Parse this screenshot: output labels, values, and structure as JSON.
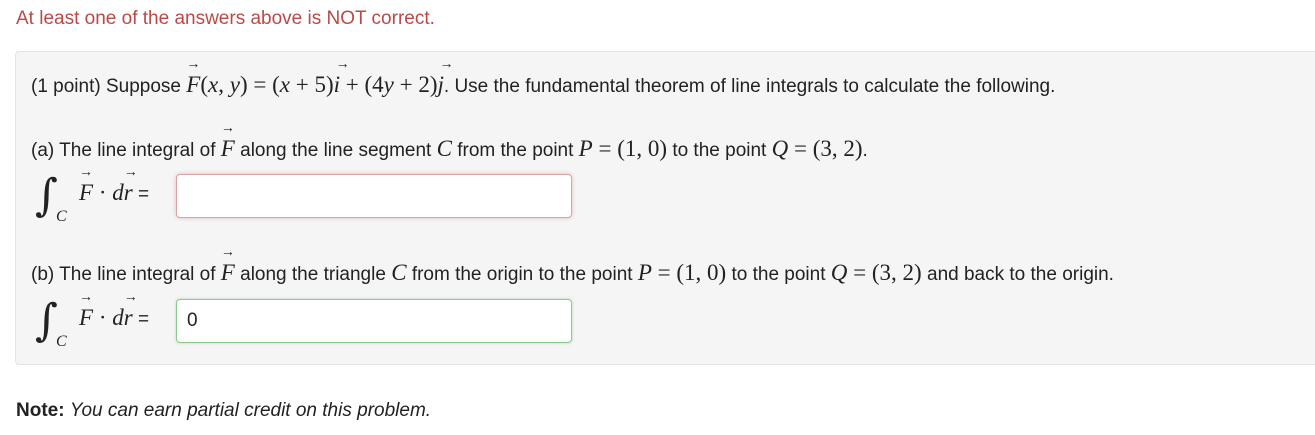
{
  "status_message": "At least one of the answers above is NOT correct.",
  "colors": {
    "error_text": "#b94a48",
    "problem_background": "#f5f5f5",
    "incorrect_border": "#d9a3a3",
    "correct_border": "#8cc98c"
  },
  "problem": {
    "points": "(1 point)",
    "suppose": "Suppose",
    "field_lhs": "F(x, y)",
    "field_rhs_i": "(x + 5)i",
    "field_rhs_j": "(4y + 2)j",
    "instruction": ". Use the fundamental theorem of line integrals to calculate the following."
  },
  "part_a": {
    "label": "(a)",
    "text_1": "The line integral of",
    "text_2": "along the line segment",
    "curve": "C",
    "text_3": "from the point",
    "point_p": "P = (1, 0)",
    "text_4": "to the point",
    "point_q": "Q = (3, 2)",
    "text_5": ".",
    "answer_value": "",
    "answer_state": "incorrect"
  },
  "part_b": {
    "label": "(b)",
    "text_1": "The line integral of",
    "text_2": "along the triangle",
    "curve": "C",
    "text_3": "from the origin to the point",
    "point_p": "P = (1, 0)",
    "text_4": "to the point",
    "point_q": "Q = (3, 2)",
    "text_5": "and back to the origin.",
    "answer_value": "0",
    "answer_state": "correct"
  },
  "integral": {
    "subscript": "C",
    "equals": "="
  },
  "note": {
    "label": "Note:",
    "text": "You can earn partial credit on this problem."
  }
}
